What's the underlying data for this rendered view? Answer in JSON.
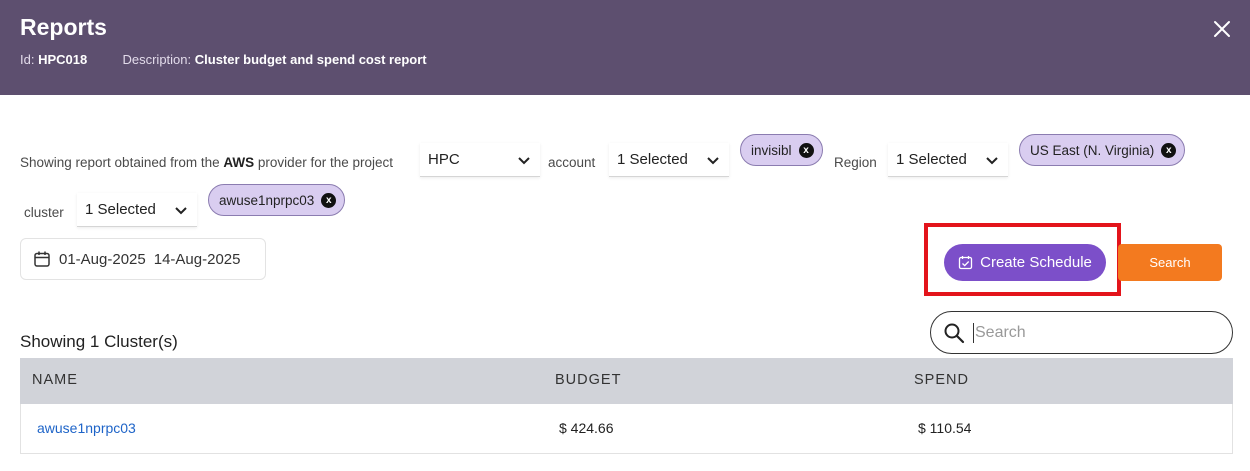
{
  "header": {
    "title": "Reports",
    "id_label": "Id:",
    "id_value": "HPC018",
    "description_label": "Description:",
    "description_value": "Cluster budget and spend cost report"
  },
  "filters": {
    "intro_text": "Showing report obtained from the",
    "provider": "AWS",
    "provider_suffix": "provider for the project",
    "project_value": "HPC",
    "account_label": "account",
    "account_value": "1 Selected",
    "account_chip": "invisibl",
    "region_label": "Region",
    "region_value": "1 Selected",
    "region_chip": "US East (N. Virginia)",
    "cluster_label": "cluster",
    "cluster_value": "1 Selected",
    "cluster_chip": "awuse1nprpc03",
    "chip_remove": "x"
  },
  "date_range": {
    "start": "01-Aug-2025",
    "end": "14-Aug-2025"
  },
  "actions": {
    "create_schedule": "Create Schedule",
    "search": "Search"
  },
  "results": {
    "showing_text": "Showing 1 Cluster(s)",
    "search_placeholder": "Search"
  },
  "table": {
    "headers": [
      "NAME",
      "BUDGET",
      "SPEND"
    ],
    "rows": [
      {
        "name": "awuse1nprpc03",
        "budget": "$ 424.66",
        "spend": "$ 110.54"
      }
    ]
  },
  "colors": {
    "header_bg": "#5d4f6f",
    "chip_bg": "#d9cdf0",
    "primary_purple": "#7c4fc9",
    "search_orange": "#f37a1f",
    "highlight_red": "#e3141b",
    "link_blue": "#1e64c8",
    "table_header_bg": "#d1d3d9"
  },
  "icons": [
    "close-icon",
    "chevron-down-icon",
    "remove-chip-icon",
    "calendar-icon",
    "calendar-check-icon",
    "search-icon"
  ]
}
